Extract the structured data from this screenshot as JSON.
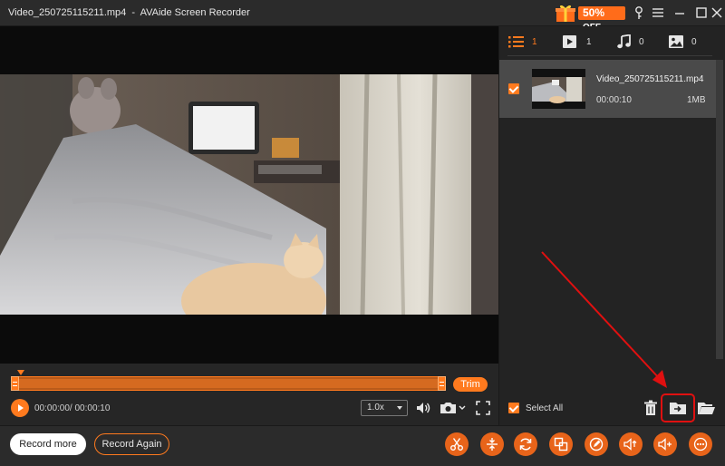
{
  "window": {
    "title": "Video_250725115211.mp4  -  AVAide Screen Recorder",
    "promo_text": "50%",
    "promo_suffix": "OFF"
  },
  "player": {
    "trim_label": "Trim",
    "time_display": "00:00:00/ 00:00:10",
    "speed_value": "1.0x"
  },
  "panel": {
    "tabs": [
      {
        "icon": "list-icon",
        "count": "1"
      },
      {
        "icon": "video-play-icon",
        "count": "1"
      },
      {
        "icon": "music-note-icon",
        "count": "0"
      },
      {
        "icon": "image-icon",
        "count": "0"
      }
    ],
    "files": [
      {
        "name": "Video_250725115211.mp4",
        "duration": "00:00:10",
        "size": "1MB",
        "checked": true
      }
    ],
    "select_all_label": "Select All"
  },
  "footer": {
    "record_more_label": "Record more",
    "record_again_label": "Record Again",
    "tools": [
      "scissors-icon",
      "compress-icon",
      "convert-icon",
      "merge-icon",
      "edit-icon",
      "volume-boost-icon",
      "audio-adjust-icon",
      "more-icon"
    ]
  },
  "colors": {
    "accent": "#ff7a1e",
    "highlight": "#e01010",
    "panel_bg": "#232323",
    "selected_row": "#4a4a4a"
  }
}
